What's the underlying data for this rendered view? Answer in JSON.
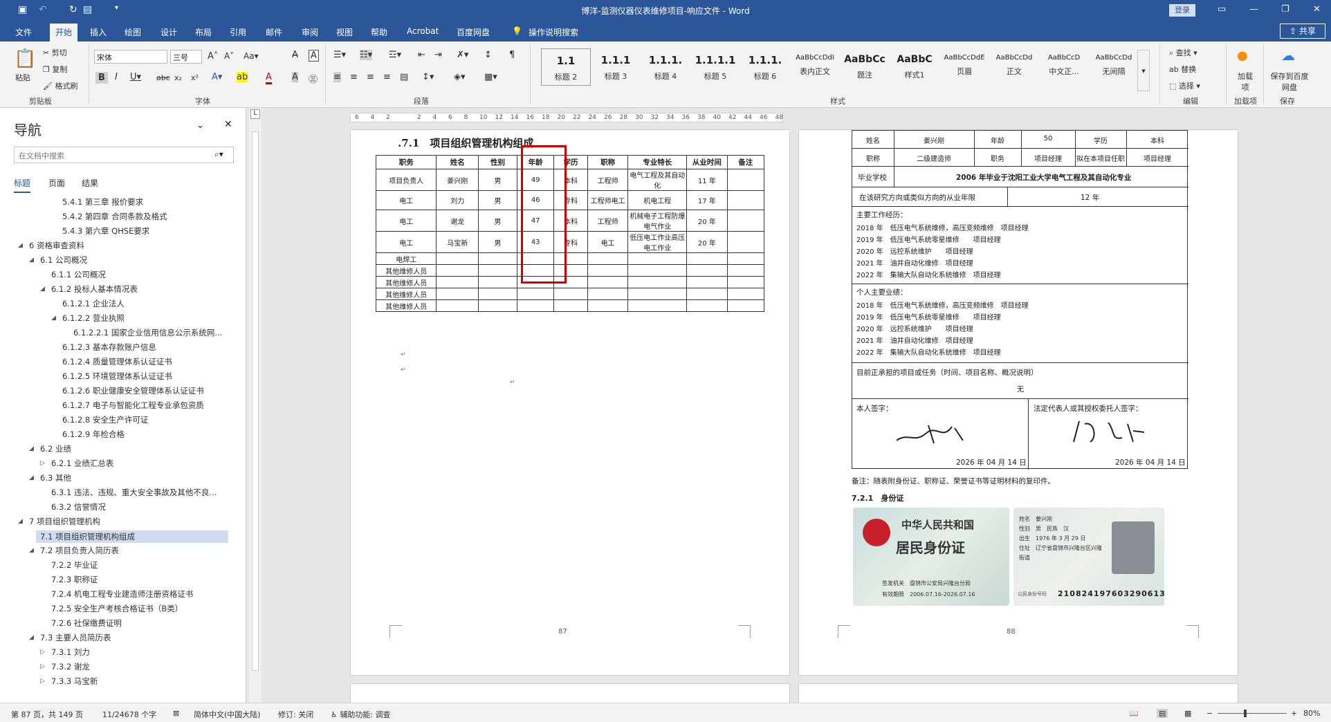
{
  "titlebar": {
    "title": "博洋-监测仪器仪表维修项目-响应文件 - Word",
    "login": "登录"
  },
  "menus": [
    "文件",
    "开始",
    "插入",
    "绘图",
    "设计",
    "布局",
    "引用",
    "邮件",
    "审阅",
    "视图",
    "帮助",
    "Acrobat",
    "百度网盘"
  ],
  "active_menu": "开始",
  "tellme": "操作说明搜索",
  "share": "共享",
  "ribbon": {
    "clipboard": {
      "paste": "粘贴",
      "cut": "剪切",
      "copy": "复制",
      "format_painter": "格式刷",
      "label": "剪贴板"
    },
    "font": {
      "name": "宋体",
      "size": "三号",
      "label": "字体"
    },
    "paragraph": {
      "label": "段落"
    },
    "styles": {
      "label": "样式",
      "items": [
        {
          "preview": "1.1",
          "name": "标题 2"
        },
        {
          "preview": "1.1.1",
          "name": "标题 3"
        },
        {
          "preview": "1.1.1.",
          "name": "标题 4"
        },
        {
          "preview": "1.1.1.1",
          "name": "标题 5"
        },
        {
          "preview": "1.1.1.",
          "name": "标题 6"
        },
        {
          "preview": "AaBbCcDdI",
          "name": "表内正文"
        },
        {
          "preview": "AaBbCc",
          "name": "题注"
        },
        {
          "preview": "AaBbC",
          "name": "样式1"
        },
        {
          "preview": "AaBbCcDdE",
          "name": "页眉"
        },
        {
          "preview": "AaBbCcDd",
          "name": "正文"
        },
        {
          "preview": "AaBbCcD",
          "name": "中文正..."
        },
        {
          "preview": "AaBbCcDd",
          "name": "无间隔"
        }
      ]
    },
    "editing": {
      "find": "查找",
      "replace": "替换",
      "select": "选择",
      "label": "编辑"
    },
    "addins": {
      "name": "加载项",
      "label": "加载项"
    },
    "save": {
      "name": "保存到百度网盘",
      "label": "保存"
    }
  },
  "nav": {
    "title": "导航",
    "search_placeholder": "在文档中搜索",
    "tabs": [
      "标题",
      "页面",
      "结果"
    ],
    "items": [
      {
        "text": "5.4.1 第三章 报价要求",
        "level": 4
      },
      {
        "text": "5.4.2 第四章 合同条款及格式",
        "level": 4
      },
      {
        "text": "5.4.3 第六章 QHSE要求",
        "level": 4
      },
      {
        "text": "6 资格审查资料",
        "level": 1,
        "exp": "open"
      },
      {
        "text": "6.1 公司概况",
        "level": 2,
        "exp": "open"
      },
      {
        "text": "6.1.1 公司概况",
        "level": 3
      },
      {
        "text": "6.1.2 投标人基本情况表",
        "level": 3,
        "exp": "open"
      },
      {
        "text": "6.1.2.1 企业法人",
        "level": 4
      },
      {
        "text": "6.1.2.2 营业执照",
        "level": 4,
        "exp": "open"
      },
      {
        "text": "6.1.2.2.1 国家企业信用信息公示系统网...",
        "level": 5
      },
      {
        "text": "6.1.2.3 基本存款账户信息",
        "level": 4
      },
      {
        "text": "6.1.2.4 质量管理体系认证证书",
        "level": 4
      },
      {
        "text": "6.1.2.5 环境管理体系认证证书",
        "level": 4
      },
      {
        "text": "6.1.2.6 职业健康安全管理体系认证证书",
        "level": 4
      },
      {
        "text": "6.1.2.7 电子与智能化工程专业承包资质",
        "level": 4
      },
      {
        "text": "6.1.2.8 安全生产许可证",
        "level": 4
      },
      {
        "text": "6.1.2.9 年检合格",
        "level": 4
      },
      {
        "text": "6.2 业绩",
        "level": 2,
        "exp": "open"
      },
      {
        "text": "6.2.1 业绩汇总表",
        "level": 3,
        "exp": "closed"
      },
      {
        "text": "6.3 其他",
        "level": 2,
        "exp": "open"
      },
      {
        "text": "6.3.1 违法、违规、重大安全事故及其他不良...",
        "level": 3
      },
      {
        "text": "6.3.2 信誉情况",
        "level": 3
      },
      {
        "text": "7 项目组织管理机构",
        "level": 1,
        "exp": "open"
      },
      {
        "text": "7.1 项目组织管理机构组成",
        "level": 2,
        "selected": true
      },
      {
        "text": "7.2 项目负责人简历表",
        "level": 2,
        "exp": "open"
      },
      {
        "text": "7.2.2 毕业证",
        "level": 3
      },
      {
        "text": "7.2.3 职称证",
        "level": 3
      },
      {
        "text": "7.2.4 机电工程专业建造师注册资格证书",
        "level": 3
      },
      {
        "text": "7.2.5 安全生产考核合格证书（B类）",
        "level": 3
      },
      {
        "text": "7.2.6 社保缴费证明",
        "level": 3
      },
      {
        "text": "7.3 主要人员简历表",
        "level": 2,
        "exp": "open"
      },
      {
        "text": "7.3.1 刘力",
        "level": 3,
        "exp": "closed"
      },
      {
        "text": "7.3.2 谢龙",
        "level": 3,
        "exp": "closed"
      },
      {
        "text": "7.3.3 马宝新",
        "level": 3,
        "exp": "closed"
      }
    ]
  },
  "ruler": [
    "6",
    "4",
    "2",
    "",
    "2",
    "4",
    "6",
    "8",
    "10",
    "12",
    "14",
    "16",
    "18",
    "20",
    "22",
    "24",
    "26",
    "28",
    "30",
    "32",
    "34",
    "36",
    "38",
    "40",
    "42",
    "44",
    "46",
    "48"
  ],
  "page1": {
    "heading": ".7.1　项目组织管理机构组成",
    "headers": [
      "职务",
      "姓名",
      "性别",
      "年龄",
      "学历",
      "职称",
      "专业特长",
      "从业时间",
      "备注"
    ],
    "rows": [
      [
        "项目负责人",
        "姜兴刚",
        "男",
        "49",
        "本科",
        "工程师",
        "电气工程及其自动化",
        "11 年",
        ""
      ],
      [
        "电工",
        "刘力",
        "男",
        "46",
        "专科",
        "工程师电工",
        "机电工程",
        "17 年",
        ""
      ],
      [
        "电工",
        "谢龙",
        "男",
        "47",
        "本科",
        "工程师",
        "机械电子工程防爆电气作业",
        "20 年",
        ""
      ],
      [
        "电工",
        "马宝新",
        "男",
        "43",
        "专科",
        "电工",
        "低压电工作业高压电工作业",
        "20 年",
        ""
      ],
      [
        "电焊工",
        "",
        "",
        "",
        "",
        "",
        "",
        "",
        ""
      ],
      [
        "其他维修人员",
        "",
        "",
        "",
        "",
        "",
        "",
        "",
        ""
      ],
      [
        "其他维修人员",
        "",
        "",
        "",
        "",
        "",
        "",
        "",
        ""
      ],
      [
        "其他维修人员",
        "",
        "",
        "",
        "",
        "",
        "",
        "",
        ""
      ],
      [
        "其他维修人员",
        "",
        "",
        "",
        "",
        "",
        "",
        "",
        ""
      ]
    ],
    "page_number": "87"
  },
  "page2": {
    "row1": [
      "姓名",
      "姜兴刚",
      "年龄",
      "50",
      "学历",
      "本科"
    ],
    "row2": [
      "职称",
      "二级建造师",
      "职务",
      "项目经理",
      "拟在本项目任职",
      "项目经理"
    ],
    "school_label": "毕业学校",
    "school_value": "2006 年毕业于沈阳工业大学电气工程及其自动化专业",
    "years_label": "在该研究方向或类似方向的从业年限",
    "years_value": "12 年",
    "work_title": "主要工作经历：",
    "work": [
      "2018 年　低压电气系统维修，高压变频维修　项目经理",
      "2019 年　低压电气系统零星维修　　项目经理",
      "2020 年　远控系统维护　　项目经理",
      "2021 年　油井自动化维修　项目经理",
      "2022 年　集输大队自动化系统维修　项目经理"
    ],
    "perf_title": "个人主要业绩：",
    "perf": [
      "2018 年　低压电气系统维修，高压变频维修　项目经理",
      "2019 年　低压电气系统零星维修　　项目经理",
      "2020 年　远控系统维护　　项目经理",
      "2021 年　油井自动化维修　项目经理",
      "2022 年　集输大队自动化系统维修　项目经理"
    ],
    "current_label": "目前正承担的项目或任务（时间、项目名称、概况说明）",
    "current_value": "无",
    "sign_self": "本人签字：",
    "sign_legal": "法定代表人或其授权委托人签字：",
    "date_self": "2026 年 04 月 14 日",
    "date_legal": "2026 年 04 月 14 日",
    "note": "备注：随表附身份证、职称证、荣誉证书等证明材料的复印件。",
    "id_heading": "7.2.1　身份证",
    "id_front_title1": "中华人民共和国",
    "id_front_title2": "居民身份证",
    "id_front_authority": "签发机关　盘锦市公安局兴隆台分局",
    "id_front_valid": "有效期限　2006.07.16-2026.07.16",
    "id_back_name": "姓名　姜兴刚",
    "id_back_sex": "性别　男　民族　汉",
    "id_back_birth": "出生　1976 年 3 月 29 日",
    "id_back_addr": "住址　辽宁省盘锦市兴隆台区兴隆街道",
    "id_back_number": "210824197603290613",
    "id_back_number_label": "公民身份号码",
    "page_number": "88"
  },
  "statusbar": {
    "page": "第 87 页，共 149 页",
    "words": "11/24678 个字",
    "lang": "简体中文(中国大陆)",
    "track": "修订: 关闭",
    "access": "辅助功能: 调查",
    "zoom": "80%"
  }
}
